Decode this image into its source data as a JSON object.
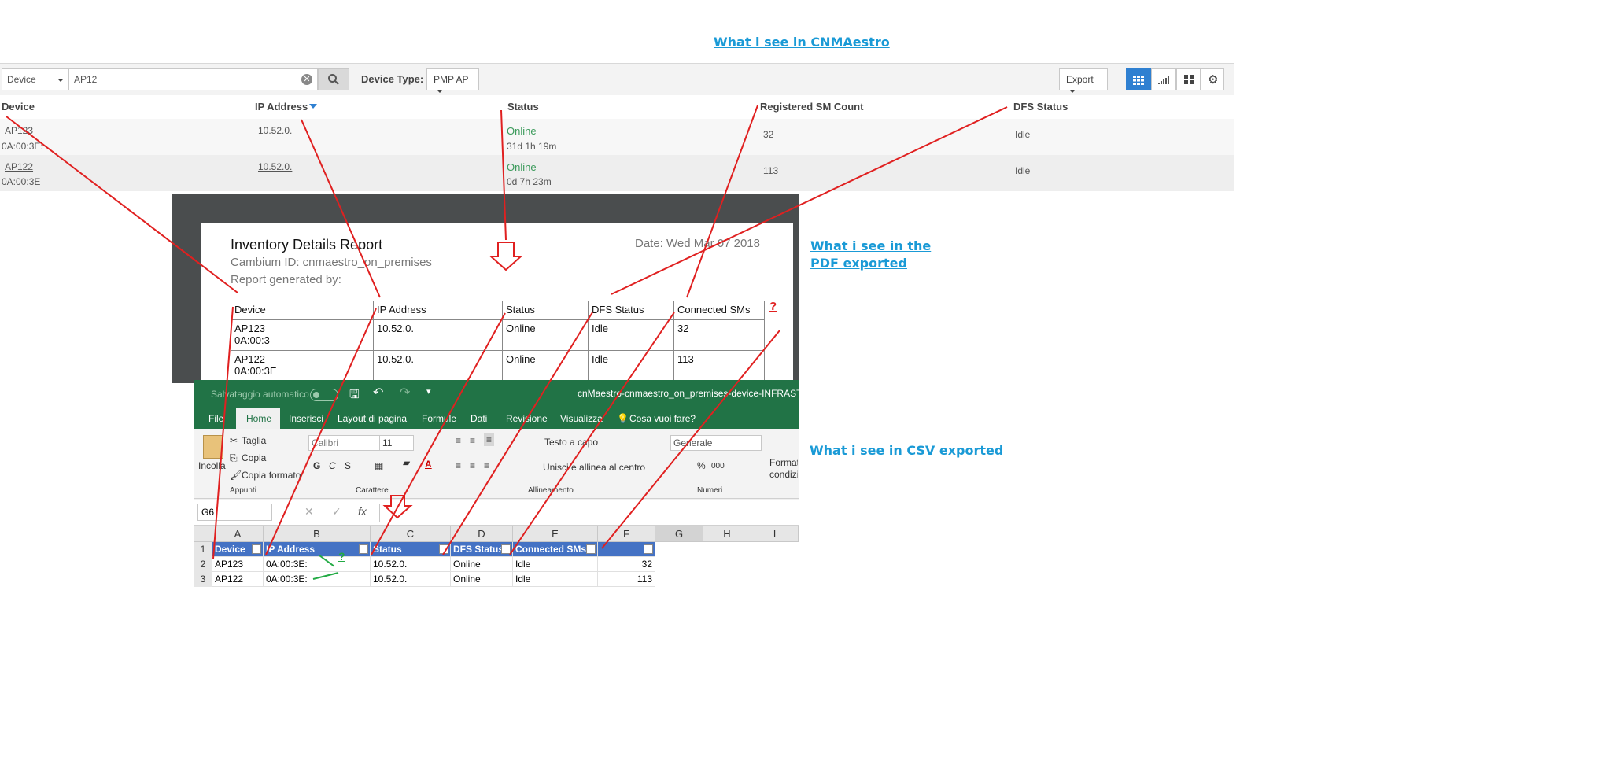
{
  "labels": {
    "cnmaestro": "What i   see in CNMAestro",
    "pdf": "What i see in the PDF exported",
    "csv": "What i see in CSV exported"
  },
  "cnm": {
    "filter_select": "Device",
    "search_value": "AP12",
    "device_type_label": "Device Type:",
    "device_type_value": "PMP AP",
    "export_label": "Export",
    "columns": [
      "Device",
      "IP Address",
      "Status",
      "Registered SM Count",
      "DFS Status"
    ],
    "rows": [
      {
        "device": "AP123",
        "mac": "0A:00:3E:",
        "ip": "10.52.0.",
        "status": "Online",
        "uptime": "31d 1h 19m",
        "sm_count": "32",
        "dfs": "Idle"
      },
      {
        "device": "AP122",
        "mac": "0A:00:3E",
        "ip": "10.52.0.",
        "status": "Online",
        "uptime": "0d 7h 23m",
        "sm_count": "113",
        "dfs": "Idle"
      }
    ]
  },
  "pdf": {
    "title": "Inventory Details Report",
    "date": "Date: Wed Mar 07 2018",
    "cambium_id": "Cambium ID: cnmaestro_on_premises",
    "generated_by": "Report generated by: ",
    "question_mark": "?",
    "columns": [
      "Device",
      "IP Address",
      "Status",
      "DFS Status",
      "Connected SMs"
    ],
    "rows": [
      {
        "device": "AP123",
        "mac": "0A:00:3",
        "ip": "10.52.0.",
        "status": "Online",
        "dfs": "Idle",
        "sms": "32"
      },
      {
        "device": "AP122",
        "mac": "0A:00:3E",
        "ip": "10.52.0.",
        "status": "Online",
        "dfs": "Idle",
        "sms": "113"
      }
    ]
  },
  "excel": {
    "autosave": "Salvataggio automatico",
    "title": "cnMaestro-cnmaestro_on_premises-device-INFRASTRUT",
    "tabs": [
      "File",
      "Home",
      "Inserisci",
      "Layout di pagina",
      "Formule",
      "Dati",
      "Revisione",
      "Visualizza",
      "Cosa vuoi fare?"
    ],
    "clipboard": {
      "paste": "Incolla",
      "cut": "Taglia",
      "copy": "Copia",
      "format_painter": "Copia formato",
      "group": "Appunti"
    },
    "font": {
      "name": "Calibri",
      "size": "11",
      "bold": "G",
      "italic": "C",
      "underline": "S",
      "group": "Carattere"
    },
    "alignment": {
      "wrap": "Testo a capo",
      "merge": "Unisci e allinea al centro",
      "group": "Allineamento"
    },
    "number": {
      "format": "Generale",
      "percent": "%",
      "thousands": "000",
      "group": "Numeri"
    },
    "styles": {
      "conditional": "Formattazione condizionale"
    },
    "name_box": "G6",
    "fx": "fx",
    "col_letters": [
      "A",
      "B",
      "C",
      "D",
      "E",
      "F",
      "G",
      "H",
      "I"
    ],
    "row_numbers": [
      "1",
      "2",
      "3"
    ],
    "header": [
      "Device",
      "IP Address",
      "Status",
      "DFS Status",
      "Connected SMs",
      ""
    ],
    "rows": [
      [
        "AP123",
        "0A:00:3E:",
        "10.52.0.",
        "Online",
        "Idle",
        "32"
      ],
      [
        "AP122",
        "0A:00:3E:",
        "10.52.0.",
        "Online",
        "Idle",
        "113"
      ]
    ],
    "question_mark": "?"
  },
  "colors": {
    "accent": "#1a9ad6",
    "excel_green": "#217346",
    "header_blue": "#4472c4",
    "annotation_red": "#e02020",
    "annotation_green": "#22aa44",
    "status_green": "#3a9a5a"
  }
}
